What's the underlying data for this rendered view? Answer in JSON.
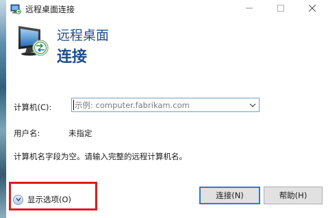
{
  "window": {
    "title": "远程桌面连接",
    "controls": {
      "minimize": "minimize",
      "maximize": "maximize",
      "close": "close"
    }
  },
  "banner": {
    "line1": "远程桌面",
    "line2": "连接",
    "icon": "remote-desktop-monitor-icon"
  },
  "form": {
    "computer_label": "计算机(C):",
    "computer_placeholder": "示例: computer.fabrikam.com",
    "computer_value": "",
    "username_label": "用户名:",
    "username_value": "未指定",
    "hint": "计算机名字段为空。请输入完整的远程计算机名。"
  },
  "footer": {
    "show_options": "显示选项(O)",
    "connect": "连接(N)",
    "help": "帮助(H)"
  },
  "colors": {
    "banner_text": "#1f4e8c",
    "highlight": "#e01818",
    "default_button_border": "#2b79d6"
  }
}
